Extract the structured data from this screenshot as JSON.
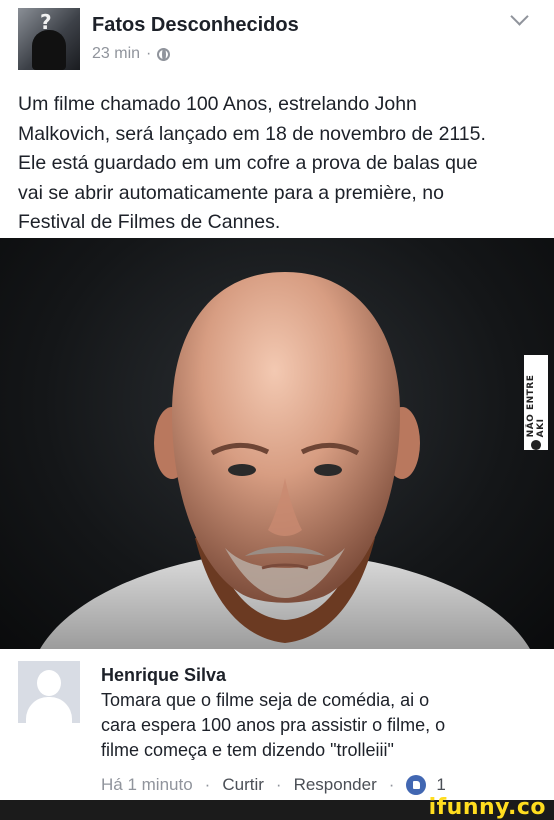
{
  "post": {
    "page_name": "Fatos Desconhecidos",
    "time": "23 min",
    "separator": "·",
    "privacy_icon": "globe-icon",
    "menu_icon": "chevron-down-icon",
    "text": "Um filme chamado 100 Anos, estrelando John\nMalkovich, será lançado em 18 de novembro de 2115.\nEle está guardado em um cofre a prova de balas que\nvai se abrir automaticamente para a première, no\nFestival de Filmes de Cannes."
  },
  "photo": {
    "watermark": "NÃO ENTRE AKI"
  },
  "comment": {
    "author": "Henrique Silva",
    "text": "Tomara que o filme seja de comédia, ai o\ncara espera 100 anos pra assistir o filme, o\nfilme começa e tem dizendo \"trolleiii\"",
    "time": "Há 1 minuto",
    "like_label": "Curtir",
    "reply_label": "Responder",
    "separator": "·",
    "like_count": "1"
  },
  "footer": {
    "logo": "ifunny.co"
  },
  "colors": {
    "link": "#4b4f56",
    "meta": "#90949c",
    "like_badge": "#4267b2",
    "logo": "#ffdd1f"
  }
}
